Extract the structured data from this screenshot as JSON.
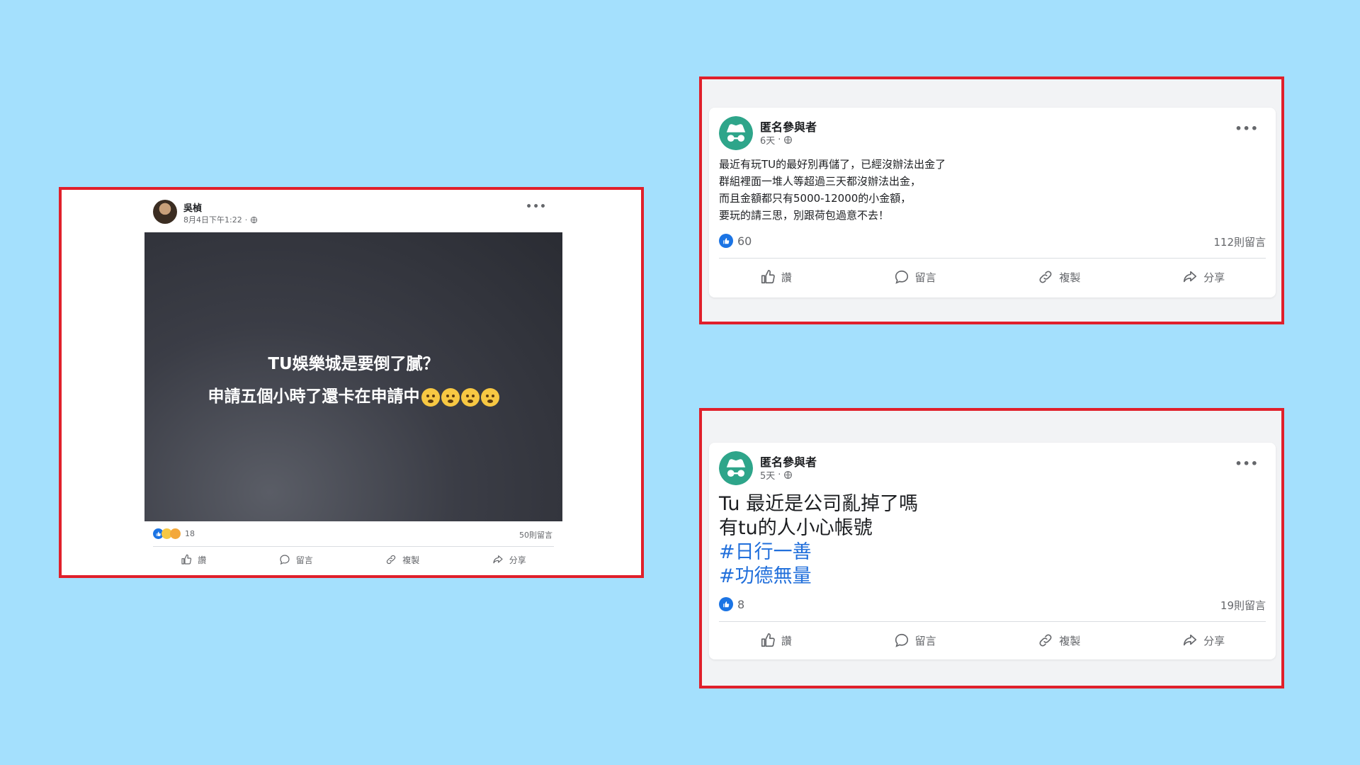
{
  "left_post": {
    "author": "吳楨",
    "timestamp": "8月4日下午1:22",
    "privacy_icon": "globe-icon",
    "more_icon": "more-dots-icon",
    "image_text_line1": "TU娛樂城是要倒了膩？",
    "image_text_line2": "申請五個小時了還卡在申請中",
    "image_emojis": [
      "worried-face",
      "worried-face",
      "thinking-face",
      "thinking-face"
    ],
    "reaction_count": "18",
    "comment_count": "50則留言",
    "actions": {
      "like": "讚",
      "comment": "留言",
      "copy": "複製",
      "share": "分享"
    }
  },
  "top_right_post": {
    "author": "匿名參與者",
    "timestamp": "6天",
    "privacy_icon": "globe-icon",
    "body": "最近有玩TU的最好別再儲了，已經沒辦法出金了\n群組裡面一堆人等超過三天都沒辦法出金，\n而且金額都只有5000-12000的小金額，\n要玩的請三思，別跟荷包過意不去！",
    "reaction_count": "60",
    "comment_count": "112則留言",
    "actions": {
      "like": "讚",
      "comment": "留言",
      "copy": "複製",
      "share": "分享"
    }
  },
  "bottom_right_post": {
    "author": "匿名參與者",
    "timestamp": "5天",
    "privacy_icon": "globe-icon",
    "body_line1": "Tu 最近是公司亂掉了嗎",
    "body_line2": "有tu的人小心帳號",
    "hashtag1": "#日行一善",
    "hashtag2": "#功德無量",
    "reaction_count": "8",
    "comment_count": "19則留言",
    "actions": {
      "like": "讚",
      "comment": "留言",
      "copy": "複製",
      "share": "分享"
    }
  },
  "colors": {
    "background": "#a4e0fd",
    "frame_border": "#e0202b",
    "like_blue": "#1b74e4",
    "hashtag_blue": "#216fdb",
    "image_dark": "#3a3c44"
  }
}
